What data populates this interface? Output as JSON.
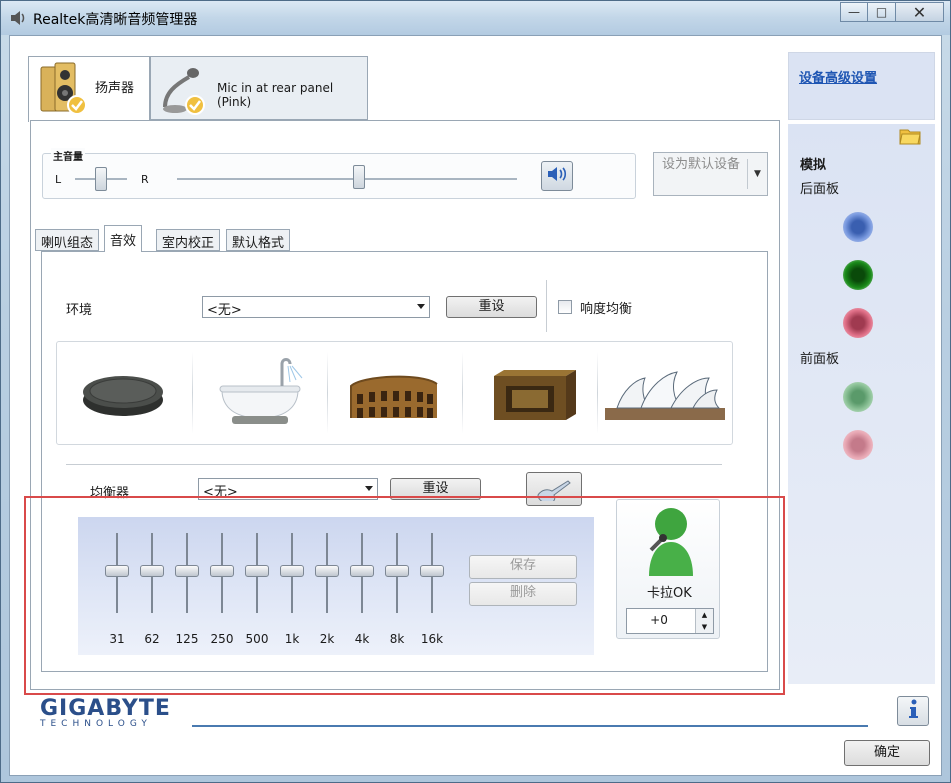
{
  "window": {
    "title": "Realtek高清晰音频管理器",
    "minimize": "—",
    "maximize": "□",
    "close": "✕"
  },
  "device_tabs": [
    {
      "label": "扬声器",
      "active": true
    },
    {
      "label": "Mic in at rear panel (Pink)",
      "active": false
    }
  ],
  "volume": {
    "caption": "主音量",
    "left": "L",
    "right": "R",
    "balance": 0.5,
    "level": 0.55
  },
  "default_device": {
    "label": "设为默认设备"
  },
  "sub_tabs": [
    "喇叭组态",
    "音效",
    "室内校正",
    "默认格式"
  ],
  "active_sub_tab": "音效",
  "environment": {
    "label": "环境",
    "value": "<无>",
    "reset": "重设",
    "loudness": "响度均衡",
    "loudness_checked": false,
    "presets": [
      "stone-disc",
      "bathtub",
      "colosseum",
      "stone-room",
      "opera-house"
    ]
  },
  "equalizer": {
    "label": "均衡器",
    "value": "<无>",
    "reset": "重设",
    "bands": [
      "31",
      "62",
      "125",
      "250",
      "500",
      "1k",
      "2k",
      "4k",
      "8k",
      "16k"
    ],
    "save": "保存",
    "delete": "删除"
  },
  "karaoke": {
    "label": "卡拉OK",
    "value": "+0"
  },
  "side": {
    "advanced_link": "设备高级设置",
    "analog": "模拟",
    "rear_panel": "后面板",
    "front_panel": "前面板",
    "colors": {
      "blue": "#5b7fd0",
      "green": "#1a8a1a",
      "pink": "#e07088",
      "front_green": "#8fc49a",
      "front_pink": "#e8a8b4"
    }
  },
  "footer": {
    "brand": "GIGABYTE",
    "brand_sub": "TECHNOLOGY",
    "ok": "确定"
  }
}
